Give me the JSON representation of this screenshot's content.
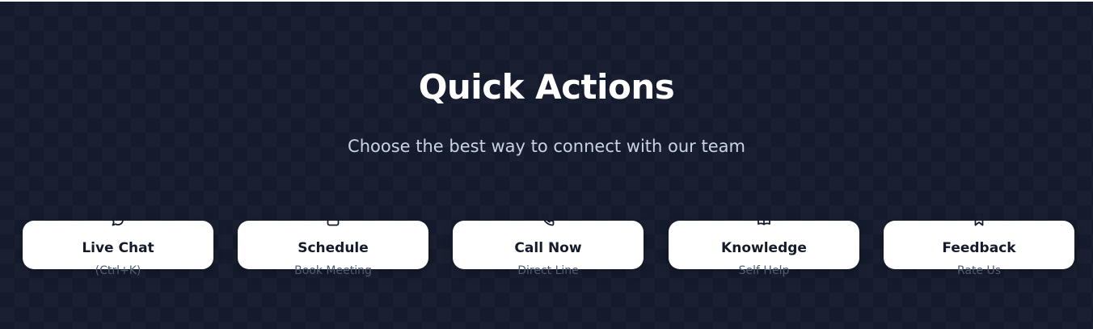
{
  "header": {
    "title": "Quick Actions",
    "subtitle": "Choose the best way to connect with our team"
  },
  "actions": [
    {
      "label": "Live Chat",
      "sublabel": "(Ctrl+K)",
      "icon": "chat-bubble-icon"
    },
    {
      "label": "Schedule",
      "sublabel": "Book Meeting",
      "icon": "calendar-icon"
    },
    {
      "label": "Call Now",
      "sublabel": "Direct Line",
      "icon": "phone-icon"
    },
    {
      "label": "Knowledge",
      "sublabel": "Self Help",
      "icon": "book-icon"
    },
    {
      "label": "Feedback",
      "sublabel": "Rate Us",
      "icon": "bookmark-icon"
    }
  ],
  "colors": {
    "background": "#141b2c",
    "card": "#ffffff",
    "title": "#ffffff",
    "subtitle": "#c9d3e3",
    "card_text": "#141b2c",
    "card_subtext": "#4f5d73"
  }
}
